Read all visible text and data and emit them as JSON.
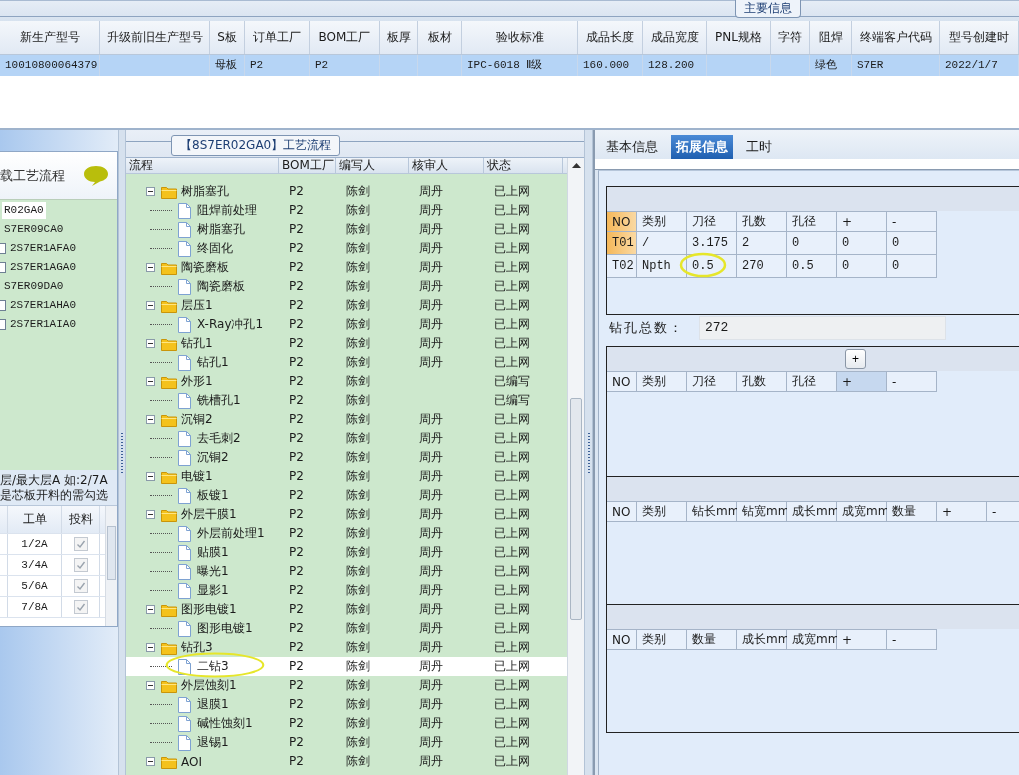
{
  "main_info": {
    "title": "主要信息",
    "columns": [
      "新生产型号",
      "升级前旧生产型号",
      "S板",
      "订单工厂",
      "BOM工厂",
      "板厚",
      "板材",
      "验收标准",
      "成品长度",
      "成品宽度",
      "PNL规格",
      "字符",
      "阻焊",
      "终端客户代码",
      "型号创建时"
    ],
    "rows": [
      {
        "cells": [
          "10010800064379",
          null,
          "母板",
          "P2",
          "P2",
          null,
          null,
          "IPC-6018 Ⅱ级",
          "160.000",
          "128.200",
          null,
          null,
          "绿色",
          "S7ER",
          "2022/1/7"
        ],
        "selected": true
      }
    ]
  },
  "load_panel": {
    "title": "载工艺流程",
    "items": [
      {
        "label": "R02GA0",
        "selected": true,
        "children": [
          {
            "label": "S7ER09CA0",
            "selected": false,
            "children": [
              {
                "label": "2S7ER1AFA0",
                "selected": false,
                "checked": false
              },
              {
                "label": "2S7ER1AGA0",
                "selected": false,
                "checked": false
              }
            ]
          },
          {
            "label": "S7ER09DA0",
            "selected": false,
            "children": [
              {
                "label": "2S7ER1AHA0",
                "selected": false,
                "checked": false
              },
              {
                "label": "2S7ER1AIA0",
                "selected": false,
                "checked": false
              }
            ]
          }
        ]
      }
    ],
    "hint": [
      "层/最大层A 如:2/7A",
      "是芯板开料的需勾选"
    ],
    "columns": [
      "工单",
      "投料"
    ],
    "rows": [
      {
        "order": "1/2A",
        "fed": true
      },
      {
        "order": "3/4A",
        "fed": true
      },
      {
        "order": "5/6A",
        "fed": true
      },
      {
        "order": "7/8A",
        "fed": true
      }
    ]
  },
  "process": {
    "title": "【8S7ER02GA0】工艺流程",
    "columns": [
      "流程",
      "BOM工厂",
      "编写人",
      "核审人",
      "状态"
    ],
    "items": [
      {
        "name": "树脂塞孔",
        "bom": "P2",
        "author": "陈剑",
        "reviewer": "周丹",
        "status": "已上网",
        "selected": false,
        "expanded": true,
        "children": [
          {
            "name": "阻焊前处理",
            "bom": "P2",
            "author": "陈剑",
            "reviewer": "周丹",
            "status": "已上网",
            "selected": false
          },
          {
            "name": "树脂塞孔",
            "bom": "P2",
            "author": "陈剑",
            "reviewer": "周丹",
            "status": "已上网",
            "selected": false
          },
          {
            "name": "终固化",
            "bom": "P2",
            "author": "陈剑",
            "reviewer": "周丹",
            "status": "已上网",
            "selected": false
          }
        ]
      },
      {
        "name": "陶瓷磨板",
        "bom": "P2",
        "author": "陈剑",
        "reviewer": "周丹",
        "status": "已上网",
        "selected": false,
        "expanded": true,
        "children": [
          {
            "name": "陶瓷磨板",
            "bom": "P2",
            "author": "陈剑",
            "reviewer": "周丹",
            "status": "已上网",
            "selected": false
          }
        ]
      },
      {
        "name": "层压1",
        "bom": "P2",
        "author": "陈剑",
        "reviewer": "周丹",
        "status": "已上网",
        "selected": false,
        "expanded": true,
        "children": [
          {
            "name": "X-Ray冲孔1",
            "bom": "P2",
            "author": "陈剑",
            "reviewer": "周丹",
            "status": "已上网",
            "selected": false
          }
        ]
      },
      {
        "name": "钻孔1",
        "bom": "P2",
        "author": "陈剑",
        "reviewer": "周丹",
        "status": "已上网",
        "selected": false,
        "expanded": true,
        "children": [
          {
            "name": "钻孔1",
            "bom": "P2",
            "author": "陈剑",
            "reviewer": "周丹",
            "status": "已上网",
            "selected": false
          }
        ]
      },
      {
        "name": "外形1",
        "bom": "P2",
        "author": "陈剑",
        "status": "已编写",
        "selected": false,
        "expanded": true,
        "children": [
          {
            "name": "铣槽孔1",
            "bom": "P2",
            "author": "陈剑",
            "status": "已编写",
            "selected": false
          }
        ]
      },
      {
        "name": "沉铜2",
        "bom": "P2",
        "author": "陈剑",
        "reviewer": "周丹",
        "status": "已上网",
        "selected": false,
        "expanded": true,
        "children": [
          {
            "name": "去毛刺2",
            "bom": "P2",
            "author": "陈剑",
            "reviewer": "周丹",
            "status": "已上网",
            "selected": false
          },
          {
            "name": "沉铜2",
            "bom": "P2",
            "author": "陈剑",
            "reviewer": "周丹",
            "status": "已上网",
            "selected": false
          }
        ]
      },
      {
        "name": "电镀1",
        "bom": "P2",
        "author": "陈剑",
        "reviewer": "周丹",
        "status": "已上网",
        "selected": false,
        "expanded": true,
        "children": [
          {
            "name": "板镀1",
            "bom": "P2",
            "author": "陈剑",
            "reviewer": "周丹",
            "status": "已上网",
            "selected": false
          }
        ]
      },
      {
        "name": "外层干膜1",
        "bom": "P2",
        "author": "陈剑",
        "reviewer": "周丹",
        "status": "已上网",
        "selected": false,
        "expanded": true,
        "children": [
          {
            "name": "外层前处理1",
            "bom": "P2",
            "author": "陈剑",
            "reviewer": "周丹",
            "status": "已上网",
            "selected": false
          },
          {
            "name": "贴膜1",
            "bom": "P2",
            "author": "陈剑",
            "reviewer": "周丹",
            "status": "已上网",
            "selected": false
          },
          {
            "name": "曝光1",
            "bom": "P2",
            "author": "陈剑",
            "reviewer": "周丹",
            "status": "已上网",
            "selected": false
          },
          {
            "name": "显影1",
            "bom": "P2",
            "author": "陈剑",
            "reviewer": "周丹",
            "status": "已上网",
            "selected": false
          }
        ]
      },
      {
        "name": "图形电镀1",
        "bom": "P2",
        "author": "陈剑",
        "reviewer": "周丹",
        "status": "已上网",
        "selected": false,
        "expanded": true,
        "children": [
          {
            "name": "图形电镀1",
            "bom": "P2",
            "author": "陈剑",
            "reviewer": "周丹",
            "status": "已上网",
            "selected": false
          }
        ]
      },
      {
        "name": "钻孔3",
        "bom": "P2",
        "author": "陈剑",
        "reviewer": "周丹",
        "status": "已上网",
        "selected": false,
        "expanded": true,
        "children": [
          {
            "name": "二钻3",
            "bom": "P2",
            "author": "陈剑",
            "reviewer": "周丹",
            "status": "已上网",
            "selected": true,
            "circled": true
          }
        ]
      },
      {
        "name": "外层蚀刻1",
        "bom": "P2",
        "author": "陈剑",
        "reviewer": "周丹",
        "status": "已上网",
        "selected": false,
        "expanded": true,
        "children": [
          {
            "name": "退膜1",
            "bom": "P2",
            "author": "陈剑",
            "reviewer": "周丹",
            "status": "已上网",
            "selected": false
          },
          {
            "name": "碱性蚀刻1",
            "bom": "P2",
            "author": "陈剑",
            "reviewer": "周丹",
            "status": "已上网",
            "selected": false
          },
          {
            "name": "退锡1",
            "bom": "P2",
            "author": "陈剑",
            "reviewer": "周丹",
            "status": "已上网",
            "selected": false
          }
        ]
      },
      {
        "name": "AOI",
        "bom": "P2",
        "author": "陈剑",
        "reviewer": "周丹",
        "status": "已上网",
        "selected": false,
        "expanded": true
      }
    ]
  },
  "details": {
    "tabs": [
      {
        "label": "基本信息",
        "selected": false
      },
      {
        "label": "拓展信息",
        "selected": true
      },
      {
        "label": "工时",
        "selected": false
      }
    ],
    "drill": {
      "columns": [
        "NO",
        "类别",
        "刀径",
        "孔数",
        "孔径",
        "+",
        "-"
      ],
      "rows": [
        {
          "current": true,
          "cells": [
            {
              "text": "T01"
            },
            {
              "text": "/"
            },
            {
              "text": "3.175"
            },
            {
              "text": "2"
            },
            {
              "text": "0"
            },
            {
              "text": "0"
            },
            {
              "text": "0"
            }
          ]
        },
        {
          "current": false,
          "cells": [
            {
              "text": "T02"
            },
            {
              "text": "Npth"
            },
            {
              "text": "0.5",
              "circled": true
            },
            {
              "text": "270"
            },
            {
              "text": "0.5"
            },
            {
              "text": "0"
            },
            {
              "text": "0"
            }
          ]
        }
      ]
    },
    "total": {
      "label": "钻孔总数：",
      "value": "272"
    },
    "grid2": {
      "columns": [
        "NO",
        "类别",
        "刀径",
        "孔数",
        "孔径",
        "+",
        "-"
      ],
      "add_button": "+"
    },
    "grid3": {
      "columns": [
        "NO",
        "类别",
        "钻长mm",
        "钻宽mm",
        "成长mm",
        "成宽mm",
        "数量",
        "+",
        "-"
      ]
    },
    "grid4": {
      "columns": [
        "NO",
        "类别",
        "数量",
        "成长mm",
        "成宽mm",
        "+",
        "-"
      ]
    }
  }
}
